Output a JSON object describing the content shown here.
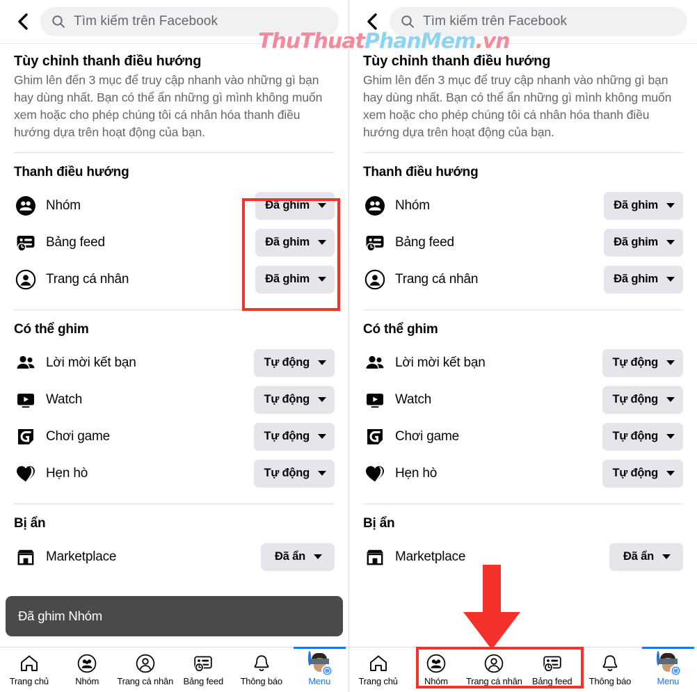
{
  "header": {
    "back_icon": "chevron-left-icon",
    "search_icon": "search-icon",
    "search_placeholder": "Tìm kiếm trên Facebook"
  },
  "intro": {
    "title": "Tùy chỉnh thanh điều hướng",
    "body": "Ghim lên đến 3 mục để truy cập nhanh vào những gì bạn hay dùng nhất. Bạn có thể ẩn những gì mình không muốn xem hoặc cho phép chúng tôi cá nhân hóa thanh điều hướng dựa trên hoạt động của bạn."
  },
  "sections": [
    {
      "title": "Thanh điều hướng",
      "rows": [
        {
          "icon": "groups-icon",
          "label": "Nhóm",
          "value": "Đã ghim"
        },
        {
          "icon": "feeds-icon",
          "label": "Bảng feed",
          "value": "Đã ghim"
        },
        {
          "icon": "profile-icon",
          "label": "Trang cá nhân",
          "value": "Đã ghim"
        }
      ]
    },
    {
      "title": "Có thể ghim",
      "rows": [
        {
          "icon": "friend-requests-icon",
          "label": "Lời mời kết bạn",
          "value": "Tự động"
        },
        {
          "icon": "watch-icon",
          "label": "Watch",
          "value": "Tự động"
        },
        {
          "icon": "gaming-icon",
          "label": "Chơi game",
          "value": "Tự động"
        },
        {
          "icon": "dating-icon",
          "label": "Hẹn hò",
          "value": "Tự động"
        }
      ]
    },
    {
      "title": "Bị ẩn",
      "rows": [
        {
          "icon": "marketplace-icon",
          "label": "Marketplace",
          "value": "Đã ẩn"
        }
      ]
    }
  ],
  "toast": {
    "message": "Đã ghim Nhóm"
  },
  "bottom_nav": {
    "items": [
      {
        "icon": "home-icon",
        "label": "Trang chủ",
        "active": false
      },
      {
        "icon": "groups-outline-icon",
        "label": "Nhóm",
        "active": false
      },
      {
        "icon": "profile-outline-icon",
        "label": "Trang cá nhân",
        "active": false
      },
      {
        "icon": "feeds-outline-icon",
        "label": "Bảng feed",
        "active": false
      },
      {
        "icon": "bell-icon",
        "label": "Thông báo",
        "active": false
      },
      {
        "icon": "avatar-menu-icon",
        "label": "Menu",
        "active": true
      }
    ]
  },
  "annotations": {
    "highlight_color": "#f5312b",
    "arrow_color": "#f5312b",
    "left_highlight_target": "pinned-dropdown-group",
    "right_highlight_target": "bottom-nav-pinned-group",
    "arrow_direction": "down"
  },
  "watermark": {
    "part1": "ThuThuat",
    "part2": "PhanMem",
    "part3": ".vn",
    "color1": "#f48a9c",
    "color2": "#8fd3f4"
  }
}
